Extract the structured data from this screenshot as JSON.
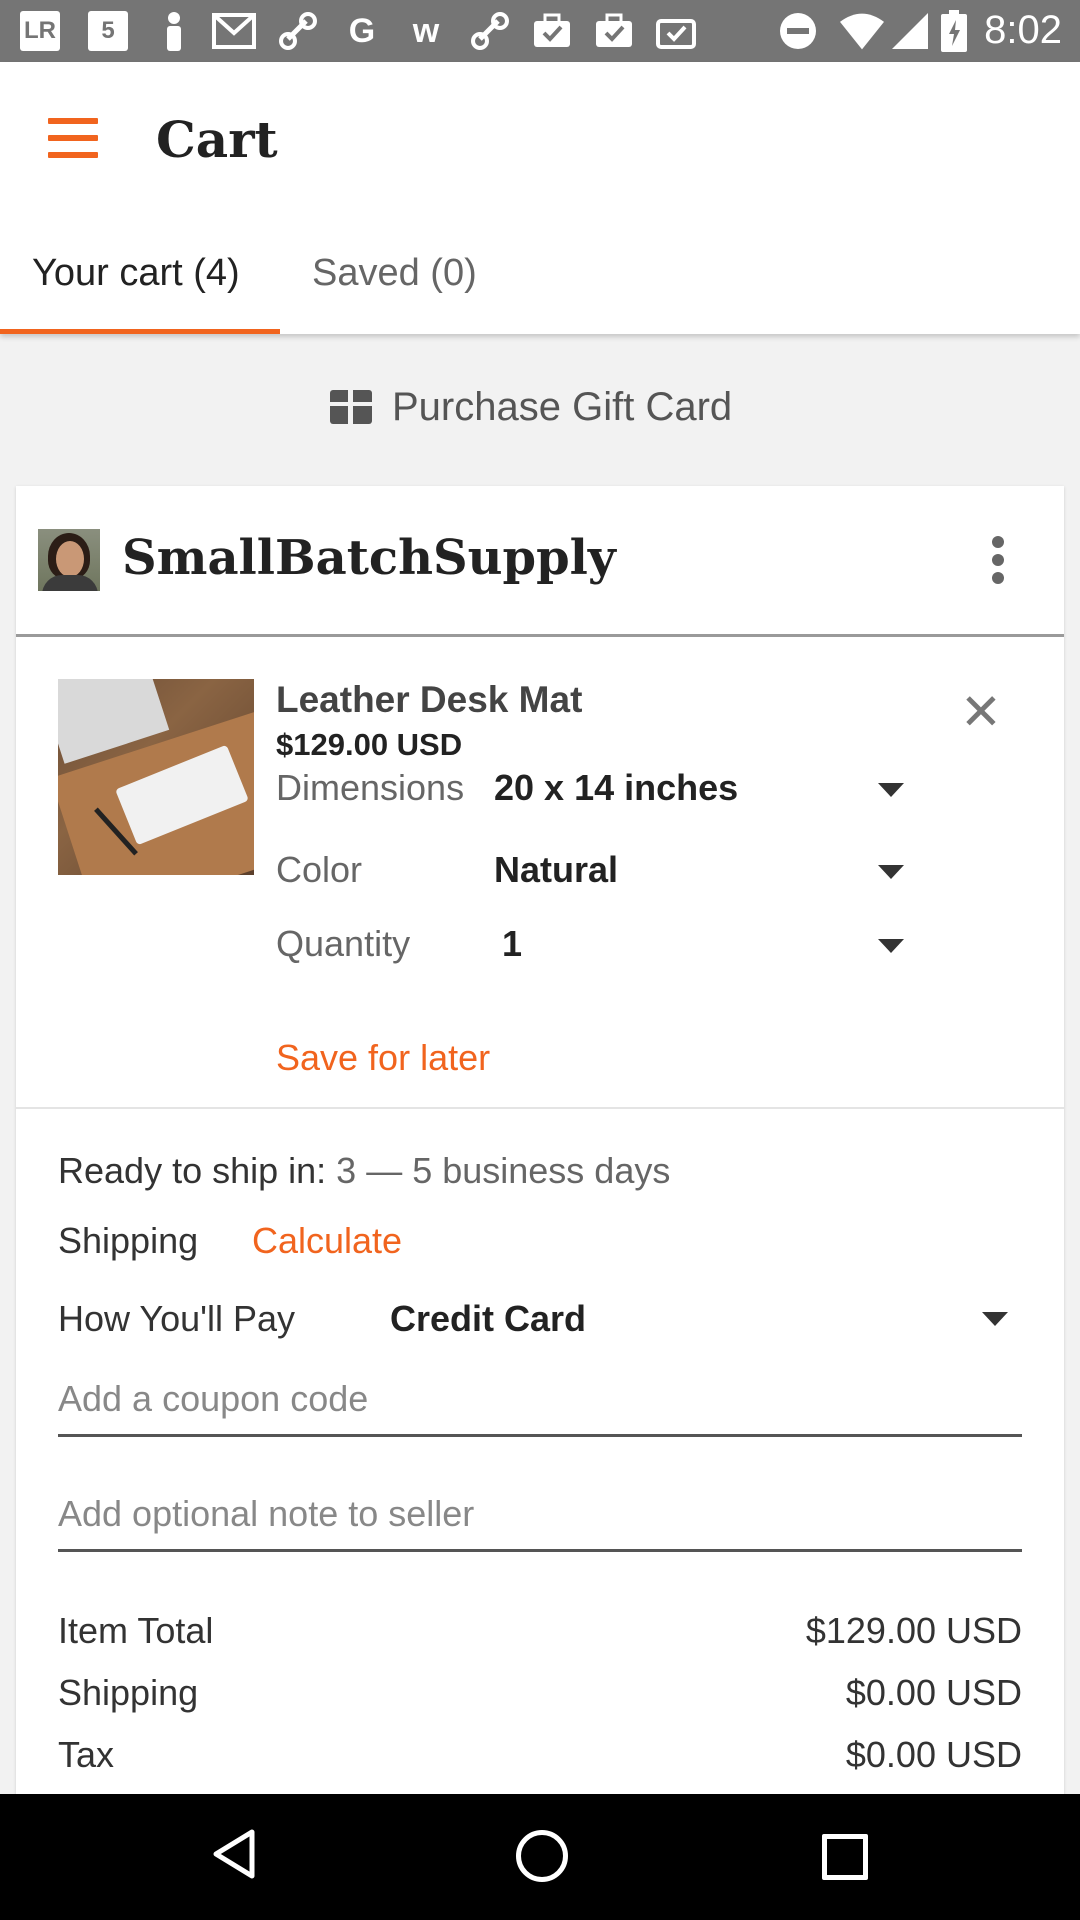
{
  "status_bar": {
    "time": "8:02",
    "left_icons": [
      "lr-app-icon",
      "app-icon-5",
      "person-icon",
      "mail-icon",
      "link-icon",
      "google-icon",
      "w-icon",
      "link-icon",
      "briefcase-check-icon",
      "briefcase-check-icon",
      "clipboard-check-icon"
    ],
    "right_icons": [
      "do-not-disturb-icon",
      "wifi-icon",
      "signal-icon",
      "battery-charging-icon"
    ]
  },
  "app_bar": {
    "title": "Cart",
    "tabs": [
      {
        "label": "Your cart (4)",
        "active": true
      },
      {
        "label": "Saved (0)",
        "active": false
      }
    ]
  },
  "gift_card": {
    "label": "Purchase Gift Card"
  },
  "shop": {
    "name": "SmallBatchSupply"
  },
  "item": {
    "title": "Leather Desk Mat",
    "price": "$129.00 USD",
    "options": [
      {
        "label": "Dimensions",
        "value": "20 x 14 inches"
      },
      {
        "label": "Color",
        "value": "Natural"
      },
      {
        "label": "Quantity",
        "value": "1"
      }
    ],
    "save_for_later": "Save for later"
  },
  "shipping": {
    "ready_label": "Ready to ship in:",
    "ready_value": "3 — 5 business days",
    "shipping_label": "Shipping",
    "calculate_link": "Calculate",
    "pay_label": "How You'll Pay",
    "pay_value": "Credit Card",
    "coupon_placeholder": "Add a coupon code",
    "note_placeholder": "Add optional note to seller"
  },
  "totals": [
    {
      "label": "Item Total",
      "value": "$129.00 USD"
    },
    {
      "label": "Shipping",
      "value": "$0.00 USD"
    },
    {
      "label": "Tax",
      "value": "$0.00 USD"
    }
  ],
  "colors": {
    "accent": "#f1641e",
    "status_bar": "#757575"
  }
}
